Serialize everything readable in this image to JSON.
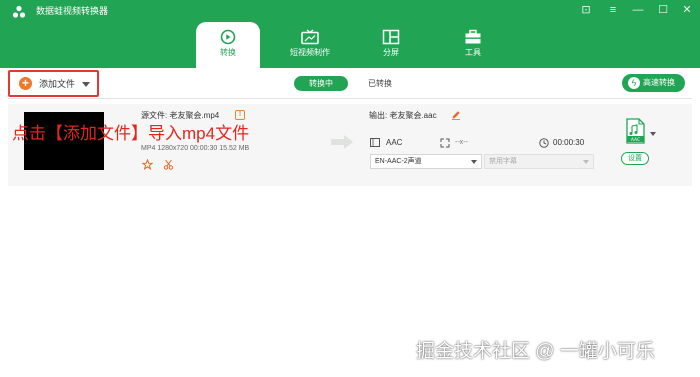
{
  "app": {
    "title": "数据蛙视频转换器",
    "accent_color": "#22a455",
    "logo_icon": "app-logo-icon"
  },
  "window_controls": [
    {
      "name": "feedback-icon",
      "glyph": "⊡"
    },
    {
      "name": "menu-icon",
      "glyph": "≡"
    },
    {
      "name": "minimize-icon",
      "glyph": "—"
    },
    {
      "name": "maximize-icon",
      "glyph": "☐"
    },
    {
      "name": "close-icon",
      "glyph": "✕"
    }
  ],
  "tabs": [
    {
      "label": "转换",
      "icon": "convert-icon",
      "active": true
    },
    {
      "label": "短视频制作",
      "icon": "tv-icon",
      "active": false
    },
    {
      "label": "分屏",
      "icon": "split-screen-icon",
      "active": false
    },
    {
      "label": "工具",
      "icon": "toolbox-icon",
      "active": false
    }
  ],
  "toolbar": {
    "add_file_label": "添加文件",
    "status_tabs": [
      "转换中",
      "已转换"
    ],
    "fast_convert_label": "高速转换",
    "highlight_color": "#e23a32"
  },
  "file": {
    "source_name": "源文件: 老友聚会.mp4",
    "meta": "MP4   1280x720   00:00:30   15.52 MB",
    "output_name": "输出: 老友聚会.aac",
    "video_track": "AAC",
    "resolution": "--x--",
    "duration": "00:00:30",
    "audio_track": "EN-AAC-2声道",
    "subtitle": "禁用字幕",
    "format_badge": "AAC",
    "settings_label": "设置"
  },
  "annotation": {
    "text": "点击【添加文件】导入mp4文件",
    "color": "#e3261e"
  },
  "watermark": "掘金技术社区 @ 一罐小可乐"
}
